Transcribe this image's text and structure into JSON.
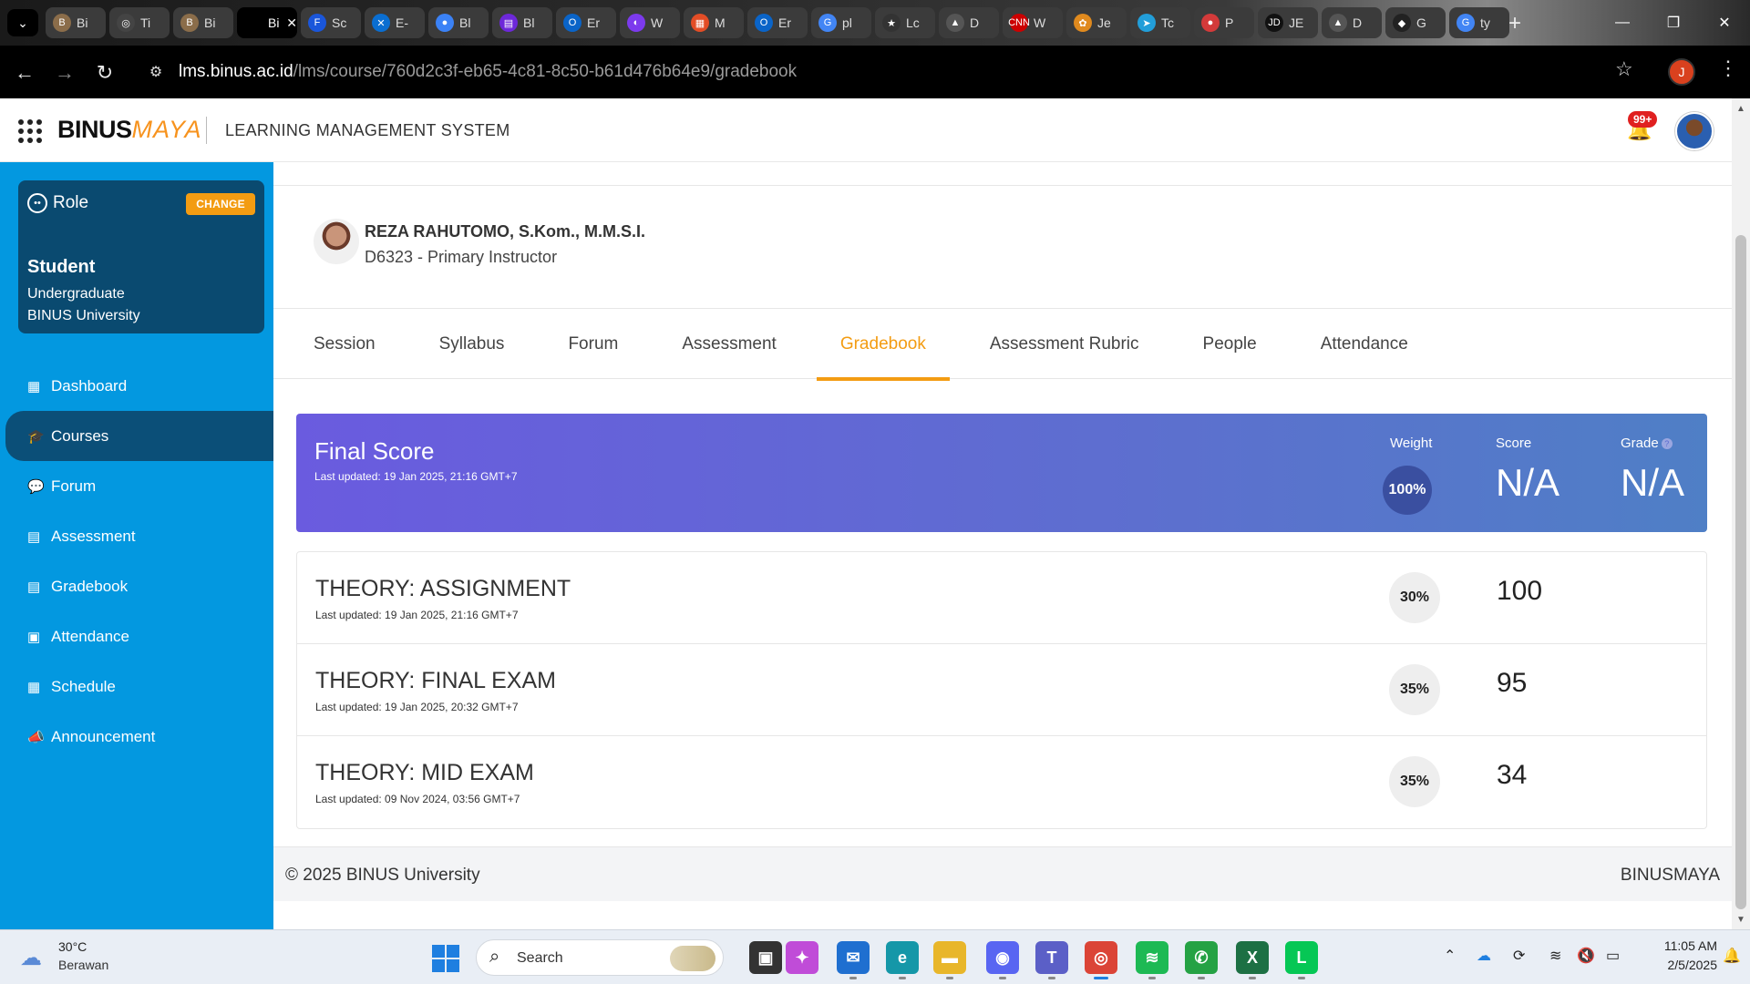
{
  "browser": {
    "tabs": [
      {
        "label": "Bi",
        "favicon": "B",
        "color": "#8b6d4a",
        "active": false
      },
      {
        "label": "Ti",
        "favicon": "◎",
        "color": "#444444",
        "active": false
      },
      {
        "label": "Bi",
        "favicon": "B",
        "color": "#8b6d4a",
        "active": false
      },
      {
        "label": "Bi",
        "favicon": "",
        "color": "#000000",
        "active": true
      },
      {
        "label": "Sc",
        "favicon": "F",
        "color": "#1a56db",
        "active": false
      },
      {
        "label": "E-",
        "favicon": "✕",
        "color": "#0a6ed1",
        "active": false
      },
      {
        "label": "Bl",
        "favicon": "●",
        "color": "#3b82f6",
        "active": false
      },
      {
        "label": "Bl",
        "favicon": "▤",
        "color": "#6d28d9",
        "active": false
      },
      {
        "label": "Er",
        "favicon": "O",
        "color": "#0a64c8",
        "active": false
      },
      {
        "label": "W",
        "favicon": "◐",
        "color": "#7c3aed",
        "active": false
      },
      {
        "label": "M",
        "favicon": "▦",
        "color": "#e34d26",
        "active": false
      },
      {
        "label": "Er",
        "favicon": "O",
        "color": "#0a64c8",
        "active": false
      },
      {
        "label": "pl",
        "favicon": "G",
        "color": "#4285f4",
        "active": false
      },
      {
        "label": "Lc",
        "favicon": "★",
        "color": "#333333",
        "active": false
      },
      {
        "label": "D",
        "favicon": "▲",
        "color": "#555555",
        "active": false
      },
      {
        "label": "W",
        "favicon": "CNN",
        "color": "#cc0000",
        "active": false
      },
      {
        "label": "Je",
        "favicon": "✿",
        "color": "#e08a1e",
        "active": false
      },
      {
        "label": "Tc",
        "favicon": "➤",
        "color": "#229ed9",
        "active": false
      },
      {
        "label": "P",
        "favicon": "●",
        "color": "#d33a3a",
        "active": false
      },
      {
        "label": "JE",
        "favicon": "JD",
        "color": "#111111",
        "active": false
      },
      {
        "label": "D",
        "favicon": "▲",
        "color": "#555555",
        "active": false
      },
      {
        "label": "G",
        "favicon": "◆",
        "color": "#222222",
        "active": false
      },
      {
        "label": "ty",
        "favicon": "G",
        "color": "#4285f4",
        "active": false
      }
    ],
    "url_domain": "lms.binus.ac.id",
    "url_path": "/lms/course/760d2c3f-eb65-4c81-8c50-b61d476b64e9/gradebook",
    "profile_initial": "J"
  },
  "header": {
    "logo_binus": "BINUS",
    "logo_maya": "MAYA",
    "title": "LEARNING MANAGEMENT SYSTEM",
    "notification_count": "99+"
  },
  "sidebar": {
    "role_label": "Role",
    "change_label": "CHANGE",
    "role_name": "Student",
    "role_level": "Undergraduate",
    "role_org": "BINUS University",
    "items": [
      {
        "label": "Dashboard",
        "icon": "▦",
        "active": false
      },
      {
        "label": "Courses",
        "icon": "🎓",
        "active": true
      },
      {
        "label": "Forum",
        "icon": "💬",
        "active": false
      },
      {
        "label": "Assessment",
        "icon": "▤",
        "active": false
      },
      {
        "label": "Gradebook",
        "icon": "▤",
        "active": false
      },
      {
        "label": "Attendance",
        "icon": "▣",
        "active": false
      },
      {
        "label": "Schedule",
        "icon": "▦",
        "active": false
      },
      {
        "label": "Announcement",
        "icon": "📣",
        "active": false
      }
    ]
  },
  "instructor": {
    "name": "REZA RAHUTOMO, S.Kom., M.M.S.I.",
    "role": "D6323 - Primary Instructor"
  },
  "course_tabs": [
    {
      "label": "Session",
      "active": false
    },
    {
      "label": "Syllabus",
      "active": false
    },
    {
      "label": "Forum",
      "active": false
    },
    {
      "label": "Assessment",
      "active": false
    },
    {
      "label": "Gradebook",
      "active": true
    },
    {
      "label": "Assessment Rubric",
      "active": false
    },
    {
      "label": "People",
      "active": false
    },
    {
      "label": "Attendance",
      "active": false
    }
  ],
  "final_score": {
    "title": "Final Score",
    "updated": "Last updated: 19 Jan 2025, 21:16 GMT+7",
    "weight_label": "Weight",
    "score_label": "Score",
    "grade_label": "Grade",
    "weight": "100%",
    "score": "N/A",
    "grade": "N/A"
  },
  "scores": [
    {
      "title": "THEORY: ASSIGNMENT",
      "updated": "Last updated: 19 Jan 2025, 21:16 GMT+7",
      "weight": "30%",
      "score": "100"
    },
    {
      "title": "THEORY: FINAL EXAM",
      "updated": "Last updated: 19 Jan 2025, 20:32 GMT+7",
      "weight": "35%",
      "score": "95"
    },
    {
      "title": "THEORY: MID EXAM",
      "updated": "Last updated: 09 Nov 2024, 03:56 GMT+7",
      "weight": "35%",
      "score": "34"
    }
  ],
  "footer": {
    "copyright": "© 2025 BINUS University",
    "brand": "BINUSMAYA"
  },
  "taskbar": {
    "weather_temp": "30°C",
    "weather_desc": "Berawan",
    "search_placeholder": "Search",
    "apps": [
      {
        "name": "task-view",
        "glyph": "▣",
        "color": "#333333"
      },
      {
        "name": "copilot",
        "glyph": "✦",
        "color": "#c04cd8"
      },
      {
        "name": "mail",
        "glyph": "✉",
        "color": "#1f6fd0"
      },
      {
        "name": "edge",
        "glyph": "e",
        "color": "#1597a8"
      },
      {
        "name": "file-explorer",
        "glyph": "▬",
        "color": "#e8b62a"
      },
      {
        "name": "discord",
        "glyph": "◉",
        "color": "#5865f2"
      },
      {
        "name": "teams",
        "glyph": "T",
        "color": "#5b5fc7"
      },
      {
        "name": "chrome",
        "glyph": "◎",
        "color": "#db4437"
      },
      {
        "name": "spotify",
        "glyph": "≋",
        "color": "#1db954"
      },
      {
        "name": "whatsapp",
        "glyph": "✆",
        "color": "#25a244"
      },
      {
        "name": "excel",
        "glyph": "X",
        "color": "#1d7044"
      },
      {
        "name": "line",
        "glyph": "L",
        "color": "#06c755"
      }
    ],
    "time": "11:05 AM",
    "date": "2/5/2025"
  }
}
